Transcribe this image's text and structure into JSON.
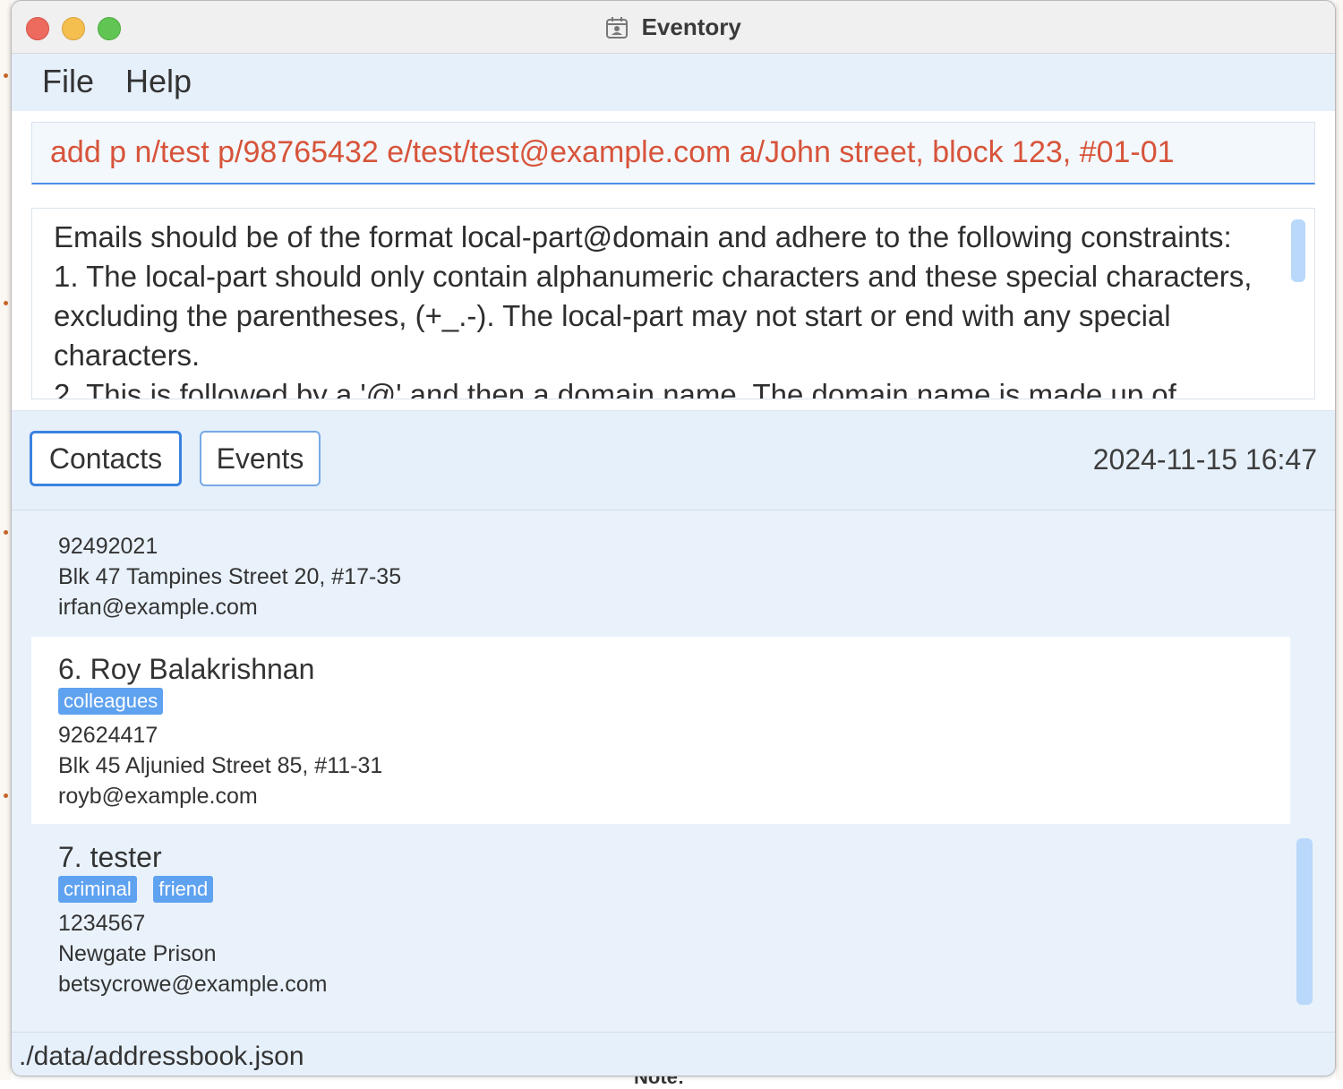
{
  "window": {
    "title": "Eventory"
  },
  "menu": {
    "file": "File",
    "help": "Help"
  },
  "command": {
    "value": "add p n/test p/98765432 e/test/test@example.com a/John street, block 123, #01-01"
  },
  "result": {
    "text": "Emails should be of the format local-part@domain and adhere to the following constraints:\n1. The local-part should only contain alphanumeric characters and these special characters, excluding the parentheses, (+_.-). The local-part may not start or end with any special characters.\n2. This is followed by a '@' and then a domain name. The domain name is made up of domain"
  },
  "tabs": {
    "contacts": "Contacts",
    "events": "Events"
  },
  "clock": "2024-11-15 16:47",
  "contacts": [
    {
      "phone": "92492021",
      "address": "Blk 47 Tampines Street 20, #17-35",
      "email": "irfan@example.com"
    },
    {
      "name": "6. Roy Balakrishnan",
      "tags": [
        "colleagues"
      ],
      "phone": "92624417",
      "address": "Blk 45 Aljunied Street 85, #11-31",
      "email": "royb@example.com"
    },
    {
      "name": "7. tester",
      "tags": [
        "criminal",
        "friend"
      ],
      "phone": "1234567",
      "address": "Newgate Prison",
      "email": "betsycrowe@example.com"
    }
  ],
  "status": {
    "path": "./data/addressbook.json"
  },
  "colors": {
    "accent": "#3b82e0",
    "tag": "#5fa2f0",
    "command_text": "#d7543a"
  },
  "background": {
    "partial_text": "Note:"
  }
}
